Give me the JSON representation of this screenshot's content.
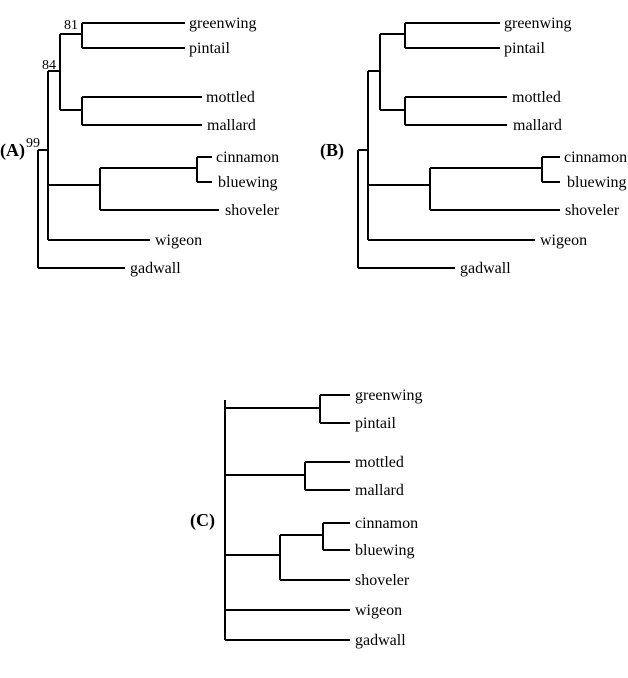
{
  "taxa": {
    "greenwing": "greenwing",
    "pintail": "pintail",
    "mottled": "mottled",
    "mallard": "mallard",
    "cinnamon": "cinnamon",
    "bluewing": "bluewing",
    "shoveler": "shoveler",
    "wigeon": "wigeon",
    "gadwall": "gadwall"
  },
  "panels": {
    "A": "(A)",
    "B": "(B)",
    "C": "(C)"
  },
  "bootstrap": {
    "b81": "81",
    "b84": "84",
    "b99": "99"
  }
}
